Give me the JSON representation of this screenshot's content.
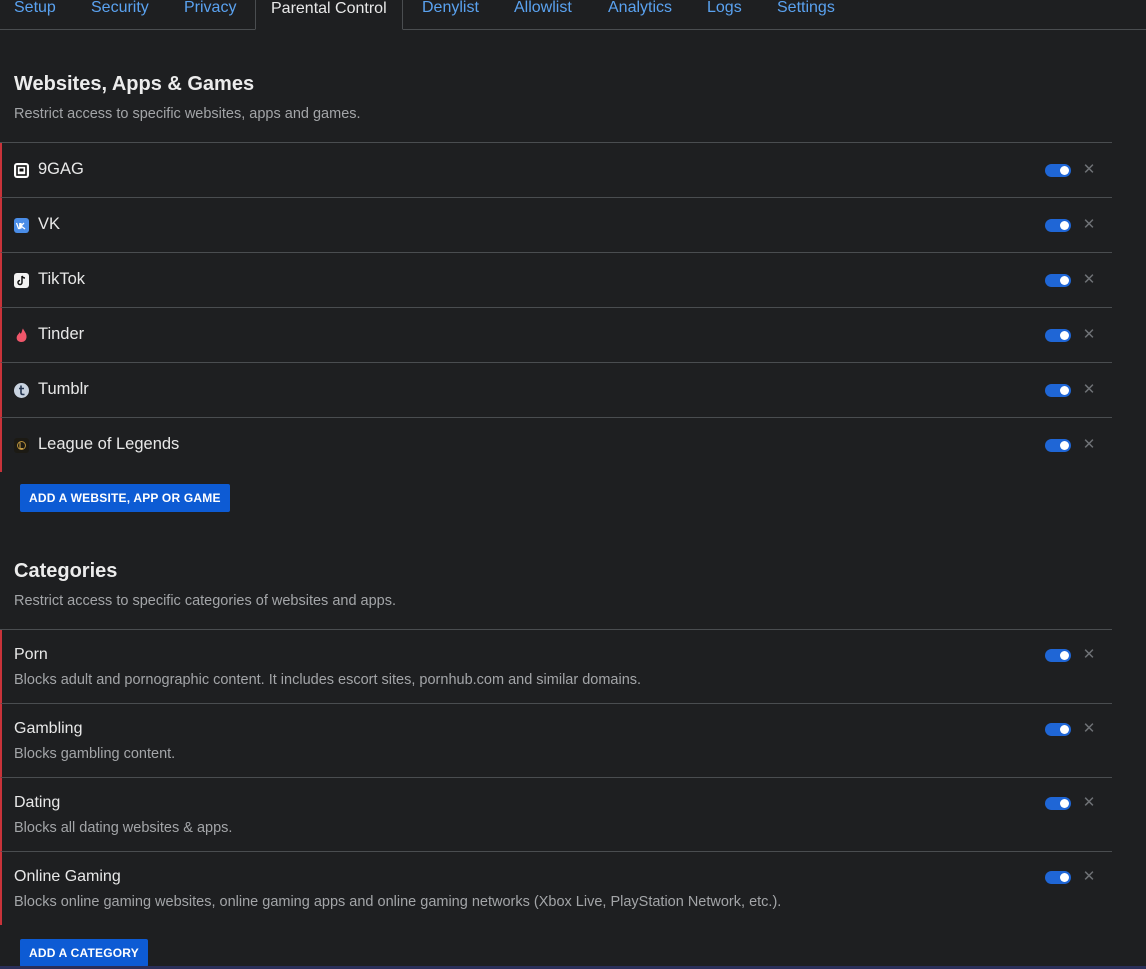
{
  "tabs": [
    {
      "label": "Setup"
    },
    {
      "label": "Security"
    },
    {
      "label": "Privacy"
    },
    {
      "label": "Parental Control",
      "active": true
    },
    {
      "label": "Denylist"
    },
    {
      "label": "Allowlist"
    },
    {
      "label": "Analytics"
    },
    {
      "label": "Logs"
    },
    {
      "label": "Settings"
    }
  ],
  "websites": {
    "title": "Websites, Apps & Games",
    "subtitle": "Restrict access to specific websites, apps and games.",
    "items": [
      {
        "name": "9GAG",
        "icon": "9gag-icon",
        "enabled": true
      },
      {
        "name": "VK",
        "icon": "vk-icon",
        "enabled": true
      },
      {
        "name": "TikTok",
        "icon": "tiktok-icon",
        "enabled": true
      },
      {
        "name": "Tinder",
        "icon": "tinder-icon",
        "enabled": true
      },
      {
        "name": "Tumblr",
        "icon": "tumblr-icon",
        "enabled": true
      },
      {
        "name": "League of Legends",
        "icon": "league-of-legends-icon",
        "enabled": true
      }
    ],
    "add_label": "ADD A WEBSITE, APP OR GAME"
  },
  "categories": {
    "title": "Categories",
    "subtitle": "Restrict access to specific categories of websites and apps.",
    "items": [
      {
        "name": "Porn",
        "description": "Blocks adult and pornographic content. It includes escort sites, pornhub.com and similar domains.",
        "enabled": true
      },
      {
        "name": "Gambling",
        "description": "Blocks gambling content.",
        "enabled": true
      },
      {
        "name": "Dating",
        "description": "Blocks all dating websites & apps.",
        "enabled": true
      },
      {
        "name": "Online Gaming",
        "description": "Blocks online gaming websites, online gaming apps and online gaming networks (Xbox Live, PlayStation Network, etc.).",
        "enabled": true
      }
    ],
    "add_label": "ADD A CATEGORY"
  },
  "colors": {
    "accent": "#1f66d6",
    "link": "#5aa2f0",
    "row_marker": "#c8333a",
    "background": "#1e1f21"
  }
}
